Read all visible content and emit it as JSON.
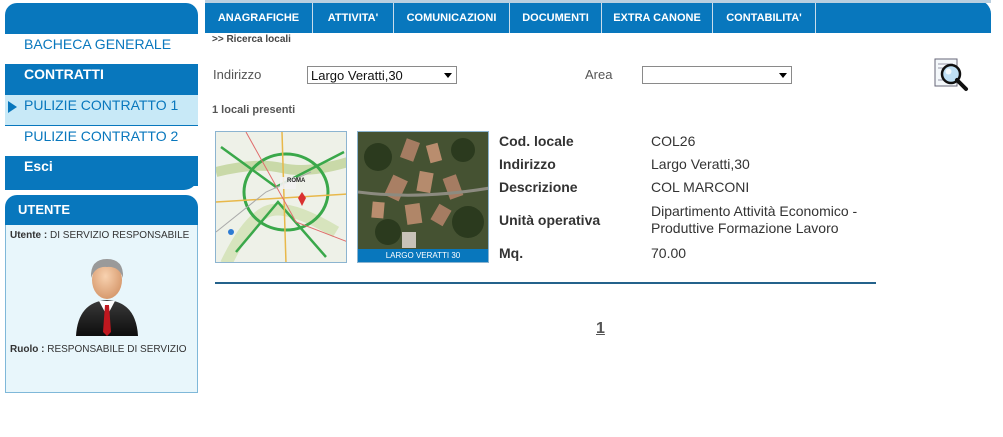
{
  "nav": {
    "items": [
      "ANAGRAFICHE",
      "ATTIVITA'",
      "COMUNICAZIONI",
      "DOCUMENTI",
      "EXTRA CANONE",
      "CONTABILITA'"
    ]
  },
  "sidebar": {
    "menu": [
      "BACHECA GENERALE",
      "CONTRATTI",
      "PULIZIE CONTRATTO 1",
      "PULIZIE CONTRATTO 2",
      "Esci"
    ],
    "selected": "PULIZIE CONTRATTO 1"
  },
  "user": {
    "title": "UTENTE",
    "utente_label": "Utente :",
    "utente_value": "DI SERVIZIO RESPONSABILE",
    "ruolo_label": "Ruolo :",
    "ruolo_value": "RESPONSABILE DI SERVIZIO"
  },
  "breadcrumb": ">> Ricerca locali",
  "filters": {
    "indirizzo_label": "Indirizzo",
    "indirizzo_value": "Largo Veratti,30",
    "area_label": "Area",
    "area_value": ""
  },
  "results": {
    "count_text": "1 locali presenti",
    "map_label": "ROMA",
    "photo_caption": "LARGO VERATTI 30",
    "fields": [
      {
        "key": "Cod. locale",
        "value": "COL26"
      },
      {
        "key": "Indirizzo",
        "value": "Largo Veratti,30"
      },
      {
        "key": "Descrizione",
        "value": "COL MARCONI"
      },
      {
        "key": "Unità operativa",
        "value": "Dipartimento Attività Economico -",
        "value2": "Produttive Formazione Lavoro"
      },
      {
        "key": "Mq.",
        "value": "70.00"
      }
    ]
  },
  "pagination": {
    "current": "1"
  },
  "colors": {
    "primary": "#0877bd",
    "selected_bg": "#c8e9f7"
  },
  "icons": {
    "search": "magnifier-icon",
    "avatar": "user-avatar-icon",
    "arrow": "triangle-right-icon"
  }
}
